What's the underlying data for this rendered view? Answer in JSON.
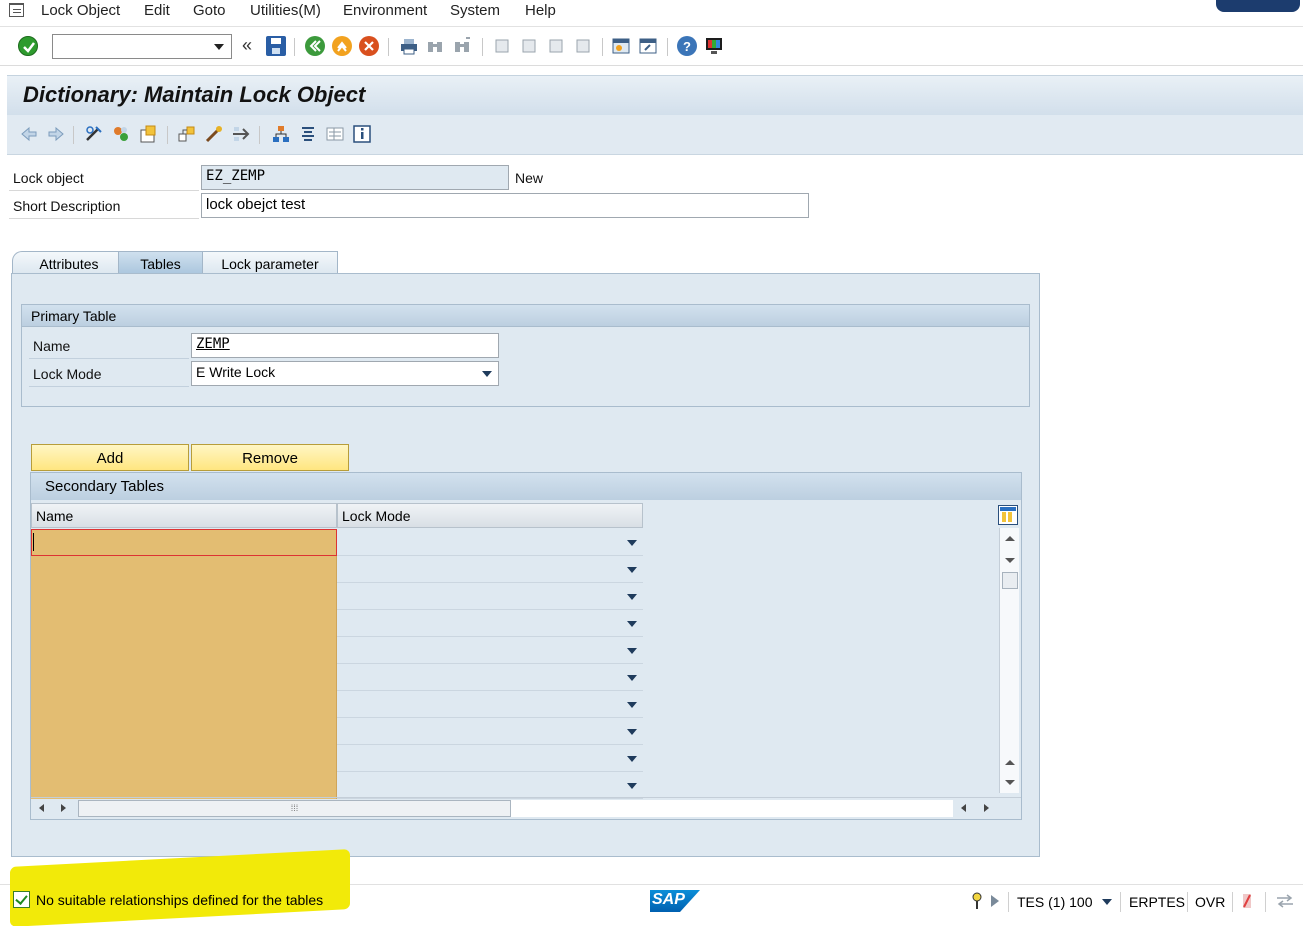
{
  "menu": {
    "items": [
      "Lock Object",
      "Edit",
      "Goto",
      "Utilities(M)",
      "Environment",
      "System",
      "Help"
    ]
  },
  "toolbar": {
    "command_value": ""
  },
  "title": "Dictionary: Maintain Lock Object",
  "header": {
    "lock_object_label": "Lock object",
    "lock_object_value": "EZ_ZEMP",
    "status": "New",
    "short_desc_label": "Short Description",
    "short_desc_value": "lock obejct test"
  },
  "tabs": [
    {
      "label": "Attributes",
      "active": false
    },
    {
      "label": "Tables",
      "active": true
    },
    {
      "label": "Lock parameter",
      "active": false
    }
  ],
  "primary_table": {
    "title": "Primary Table",
    "name_label": "Name",
    "name_value": "ZEMP",
    "lock_mode_label": "Lock Mode",
    "lock_mode_value": "E Write Lock"
  },
  "buttons": {
    "add": "Add",
    "remove": "Remove"
  },
  "secondary_tables": {
    "title": "Secondary Tables",
    "columns": [
      "Name",
      "Lock Mode"
    ],
    "rows": [
      {
        "name": "",
        "lock_mode": ""
      },
      {
        "name": "",
        "lock_mode": ""
      },
      {
        "name": "",
        "lock_mode": ""
      },
      {
        "name": "",
        "lock_mode": ""
      },
      {
        "name": "",
        "lock_mode": ""
      },
      {
        "name": "",
        "lock_mode": ""
      },
      {
        "name": "",
        "lock_mode": ""
      },
      {
        "name": "",
        "lock_mode": ""
      },
      {
        "name": "",
        "lock_mode": ""
      },
      {
        "name": "",
        "lock_mode": ""
      }
    ]
  },
  "statusbar": {
    "message": "No suitable relationships defined for the tables",
    "system": "TES (1) 100",
    "server": "ERPTES",
    "mode": "OVR"
  },
  "colors": {
    "title_bg": "#d2dfeb",
    "panel_bg": "#dfe9f1",
    "input_cell": "#e3bd72",
    "button": "#ffe680",
    "highlight": "#f2ea09"
  }
}
